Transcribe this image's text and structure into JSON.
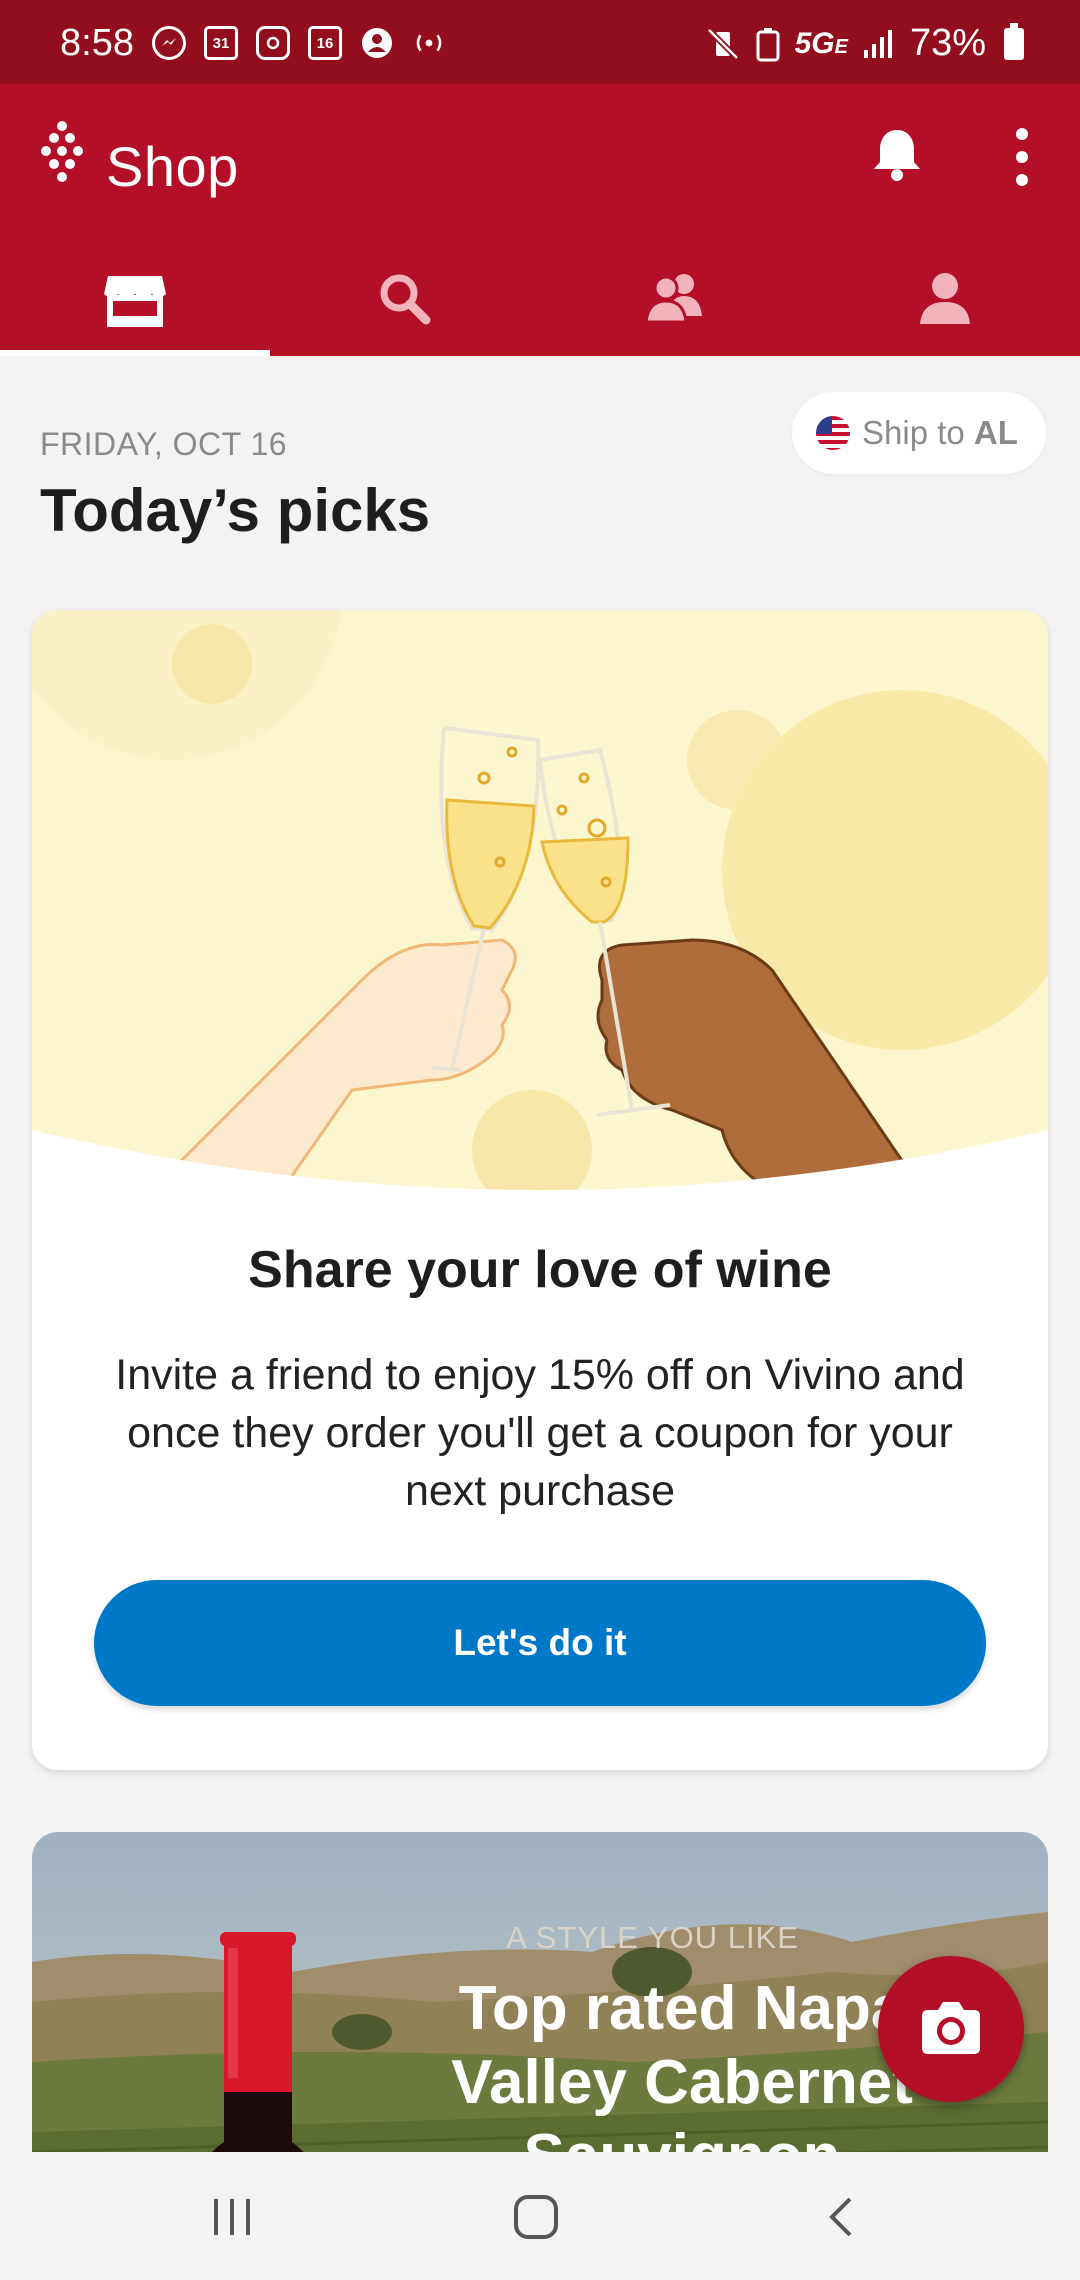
{
  "status_bar": {
    "time": "8:58",
    "calendar_day": "31",
    "calendar_day_2": "16",
    "network": "5G",
    "network_sub": "E",
    "battery": "73%"
  },
  "app_bar": {
    "title": "Shop",
    "brand_color": "#b30f26",
    "tabs": [
      {
        "icon": "store-icon",
        "active": true
      },
      {
        "icon": "search-icon",
        "active": false
      },
      {
        "icon": "community-icon",
        "active": false
      },
      {
        "icon": "profile-icon",
        "active": false
      }
    ]
  },
  "header": {
    "date": "FRIDAY, OCT 16",
    "title": "Today’s picks",
    "ship_to": {
      "prefix": "Ship to",
      "state": "AL",
      "icon": "us-flag-icon"
    }
  },
  "invite_card": {
    "title": "Share your love of wine",
    "body": "Invite a friend to enjoy 15% off on Vivino and once they order you'll get a coupon for your next purchase",
    "cta": "Let's do it",
    "cta_color": "#0078c8"
  },
  "style_card": {
    "eyebrow": "A STYLE YOU LIKE",
    "title": "Top rated Napa Valley Cabernet Sauvignon"
  },
  "fab": {
    "icon": "camera-icon"
  },
  "system_nav": {
    "icons": [
      "recents-icon",
      "home-icon",
      "back-icon"
    ]
  }
}
